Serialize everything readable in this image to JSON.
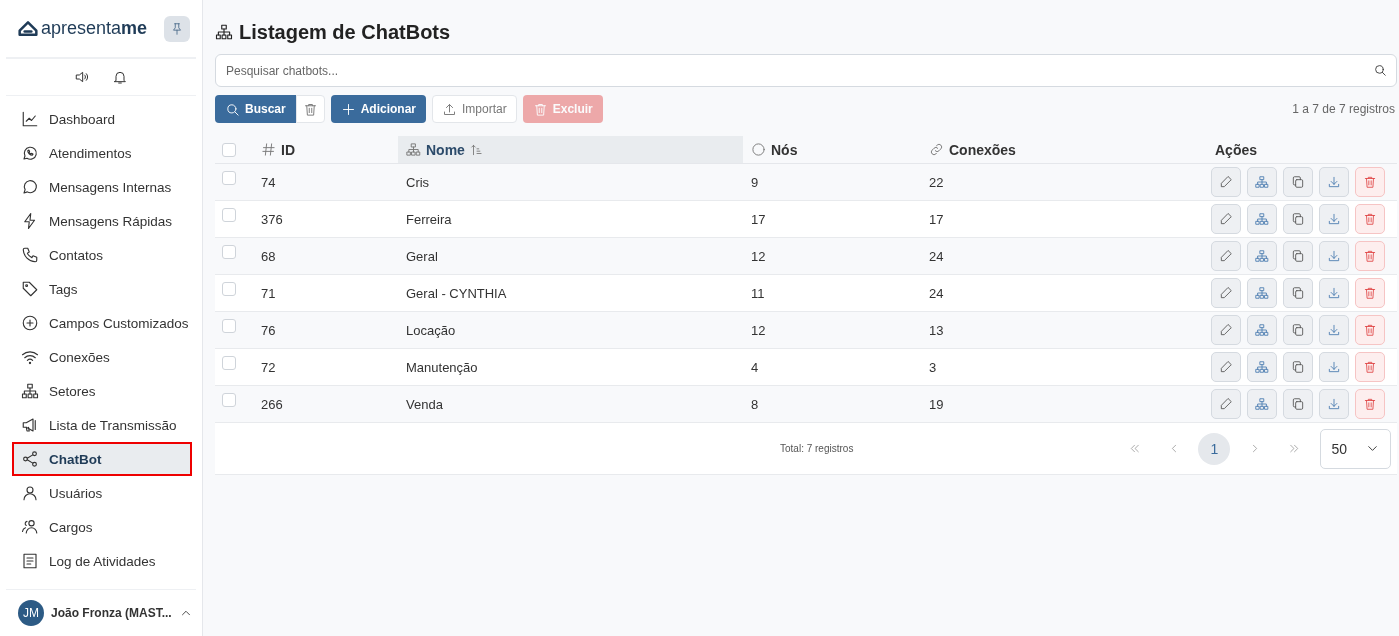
{
  "sidebar": {
    "brand": {
      "text": "apresenta",
      "bold": "me"
    },
    "items": [
      {
        "label": "Dashboard",
        "selected": false
      },
      {
        "label": "Atendimentos",
        "selected": false
      },
      {
        "label": "Mensagens Internas",
        "selected": false
      },
      {
        "label": "Mensagens Rápidas",
        "selected": false
      },
      {
        "label": "Contatos",
        "selected": false
      },
      {
        "label": "Tags",
        "selected": false
      },
      {
        "label": "Campos Customizados",
        "selected": false
      },
      {
        "label": "Conexões",
        "selected": false
      },
      {
        "label": "Setores",
        "selected": false
      },
      {
        "label": "Lista de Transmissão",
        "selected": false
      },
      {
        "label": "ChatBot",
        "selected": true
      },
      {
        "label": "Usuários",
        "selected": false
      },
      {
        "label": "Cargos",
        "selected": false
      },
      {
        "label": "Log de Atividades",
        "selected": false
      }
    ],
    "user": {
      "initials": "JM",
      "name": "João Fronza (MAST..."
    }
  },
  "page": {
    "title": "Listagem de ChatBots",
    "search": {
      "placeholder": "Pesquisar chatbots..."
    },
    "buttons": [
      {
        "kind": "search",
        "label": "Buscar",
        "disabled": false
      },
      {
        "kind": "clear",
        "disabled": false
      },
      {
        "kind": "add",
        "label": "Adicionar",
        "disabled": false
      },
      {
        "kind": "import",
        "label": "Importar",
        "disabled": false
      },
      {
        "kind": "delete",
        "label": "Excluir",
        "disabled": true
      }
    ],
    "record_count": "1 a 7 de 7 registros"
  },
  "table": {
    "all_checked": false,
    "columns": [
      {
        "label": "ID",
        "sorted": false
      },
      {
        "label": "Nome",
        "sorted": true
      },
      {
        "label": "Nós",
        "sorted": false
      },
      {
        "label": "Conexões",
        "sorted": false
      },
      {
        "label": "Ações",
        "sorted": false
      }
    ],
    "rows": [
      {
        "id": "74",
        "name": "Cris",
        "nodes": "9",
        "connections": "22",
        "checked": false
      },
      {
        "id": "376",
        "name": "Ferreira",
        "nodes": "17",
        "connections": "17",
        "checked": false
      },
      {
        "id": "68",
        "name": "Geral",
        "nodes": "12",
        "connections": "24",
        "checked": false
      },
      {
        "id": "71",
        "name": "Geral - CYNTHIA",
        "nodes": "11",
        "connections": "24",
        "checked": false
      },
      {
        "id": "76",
        "name": "Locação",
        "nodes": "12",
        "connections": "13",
        "checked": false
      },
      {
        "id": "72",
        "name": "Manutenção",
        "nodes": "4",
        "connections": "3",
        "checked": false
      },
      {
        "id": "266",
        "name": "Venda",
        "nodes": "8",
        "connections": "19",
        "checked": false
      }
    ],
    "total": "Total: 7 registros",
    "pagination": {
      "pages": [
        {
          "label": "1",
          "selected": true
        }
      ],
      "page_size": "50"
    }
  }
}
